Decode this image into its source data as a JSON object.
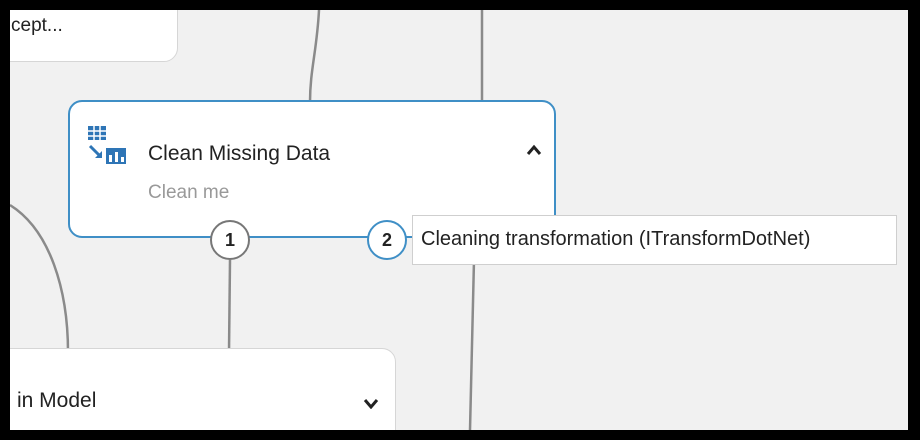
{
  "canvas": {
    "top_node": {
      "label": "cept..."
    },
    "main_node": {
      "title": "Clean Missing Data",
      "comment": "Clean me",
      "icon": "table-chart-icon",
      "collapse_icon": "chevron-up-icon",
      "ports": [
        {
          "number": "1"
        },
        {
          "number": "2"
        }
      ]
    },
    "port_tooltip": {
      "text": "Cleaning transformation (ITransformDotNet)"
    },
    "bottom_node": {
      "label": "in Model",
      "expand_icon": "chevron-down-icon"
    }
  },
  "colors": {
    "selected_border": "#3f8fc6",
    "canvas_background": "#f1f1f1",
    "connector": "#8a8a8a"
  }
}
